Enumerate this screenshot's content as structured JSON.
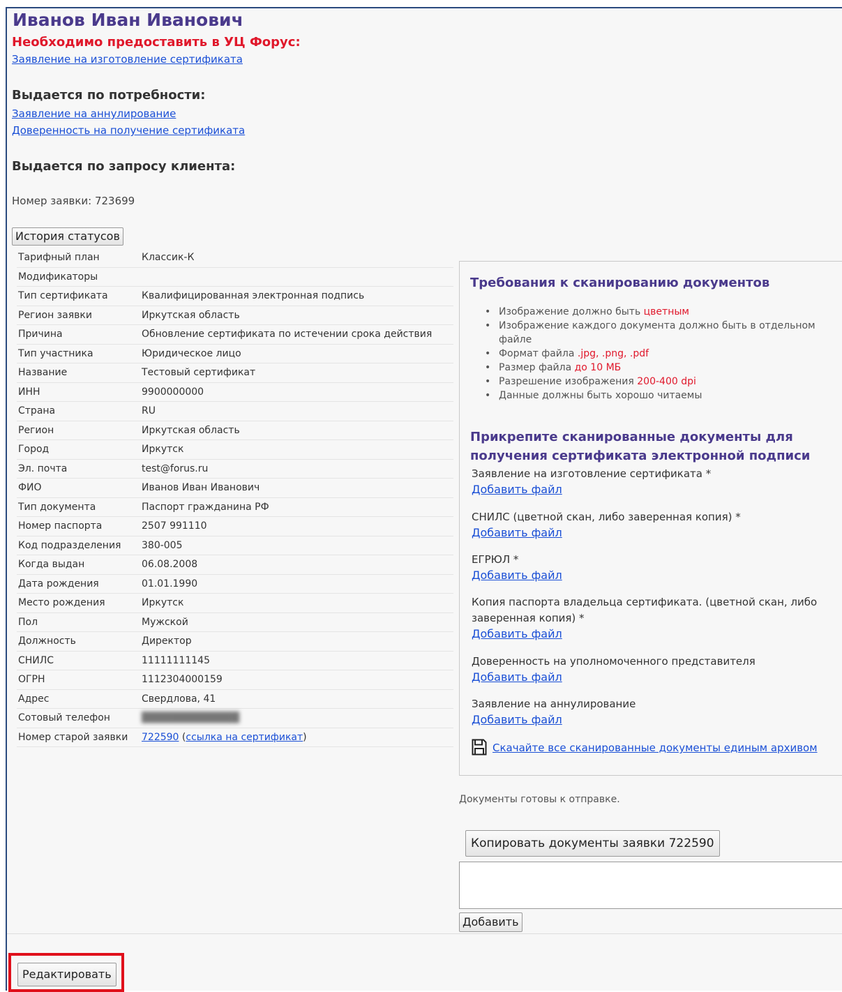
{
  "header": {
    "title": "Иванов Иван Иванович",
    "required_heading": "Необходимо предоставить в УЦ Форус:",
    "required_links": [
      "Заявление на изготовление сертификата"
    ],
    "on_demand_heading": "Выдается по потребности:",
    "on_demand_links": [
      "Заявление на аннулирование",
      "Доверенность на получение сертификата"
    ],
    "client_request_heading": "Выдается по запросу клиента:",
    "request_number": "Номер заявки: 723699"
  },
  "buttons": {
    "history": "История статусов",
    "copy_docs": "Копировать документы заявки 722590",
    "add": "Добавить",
    "edit": "Редактировать"
  },
  "details": [
    {
      "label": "Тарифный план",
      "value": "Классик-К"
    },
    {
      "label": "Модификаторы",
      "value": ""
    },
    {
      "label": "Тип сертификата",
      "value": "Квалифицированная электронная подпись"
    },
    {
      "label": "Регион заявки",
      "value": "Иркутская область"
    },
    {
      "label": "Причина",
      "value": "Обновление сертификата по истечении срока действия"
    },
    {
      "label": "Тип участника",
      "value": "Юридическое лицо"
    },
    {
      "label": "Название",
      "value": "Тестовый сертификат"
    },
    {
      "label": "ИНН",
      "value": "9900000000"
    },
    {
      "label": "Страна",
      "value": "RU"
    },
    {
      "label": "Регион",
      "value": "Иркутская область"
    },
    {
      "label": "Город",
      "value": "Иркутск"
    },
    {
      "label": "Эл. почта",
      "value": "test@forus.ru"
    },
    {
      "label": "ФИО",
      "value": "Иванов Иван Иванович"
    },
    {
      "label": "Тип документа",
      "value": "Паспорт гражданина РФ"
    },
    {
      "label": "Номер паспорта",
      "value": "2507 991110"
    },
    {
      "label": "Код подразделения",
      "value": "380-005"
    },
    {
      "label": "Когда выдан",
      "value": "06.08.2008"
    },
    {
      "label": "Дата рождения",
      "value": "01.01.1990"
    },
    {
      "label": "Место рождения",
      "value": "Иркутск"
    },
    {
      "label": "Пол",
      "value": "Мужской"
    },
    {
      "label": "Должность",
      "value": "Директор"
    },
    {
      "label": "СНИЛС",
      "value": "11111111145"
    },
    {
      "label": "ОГРН",
      "value": "1112304000159"
    },
    {
      "label": "Адрес",
      "value": "Свердлова, 41"
    },
    {
      "label": "Сотовый телефон",
      "value": ""
    }
  ],
  "old_request": {
    "label": "Номер старой заявки",
    "number": "722590",
    "open_paren": "(",
    "cert_link": "ссылка на сертификат",
    "close_paren": ")"
  },
  "requirements": {
    "heading": "Требования к сканированию документов",
    "items": [
      {
        "text": "Изображение должно быть ",
        "highlight": "цветным"
      },
      {
        "text": "Изображение каждого документа должно быть в отдельном файле",
        "highlight": ""
      },
      {
        "text": "Формат файла ",
        "highlight": ".jpg, .png, .pdf"
      },
      {
        "text": "Размер файла ",
        "highlight": "до 10 МБ"
      },
      {
        "text": "Разрешение изображения ",
        "highlight": "200-400 dpi"
      },
      {
        "text": "Данные должны быть хорошо читаемы",
        "highlight": ""
      }
    ]
  },
  "attach": {
    "heading": "Прикрепите сканированные документы для получения сертификата электронной подписи",
    "add_file_label": "Добавить файл",
    "documents": [
      "Заявление на изготовление сертификата *",
      "СНИЛС (цветной скан, либо заверенная копия) *",
      "ЕГРЮЛ *",
      "Копия паспорта владельца сертификата. (цветной скан, либо заверенная копия) *",
      "Доверенность на уполномоченного представителя",
      "Заявление на аннулирование"
    ],
    "archive_link": "Скачайте все сканированные документы единым архивом"
  },
  "status": {
    "docs_ready": "Документы готовы к отправке."
  },
  "colors": {
    "title": "#4a3a8c",
    "required": "#e0182b",
    "link": "#1a4fd6",
    "highlight_frame": "#e0101b"
  }
}
